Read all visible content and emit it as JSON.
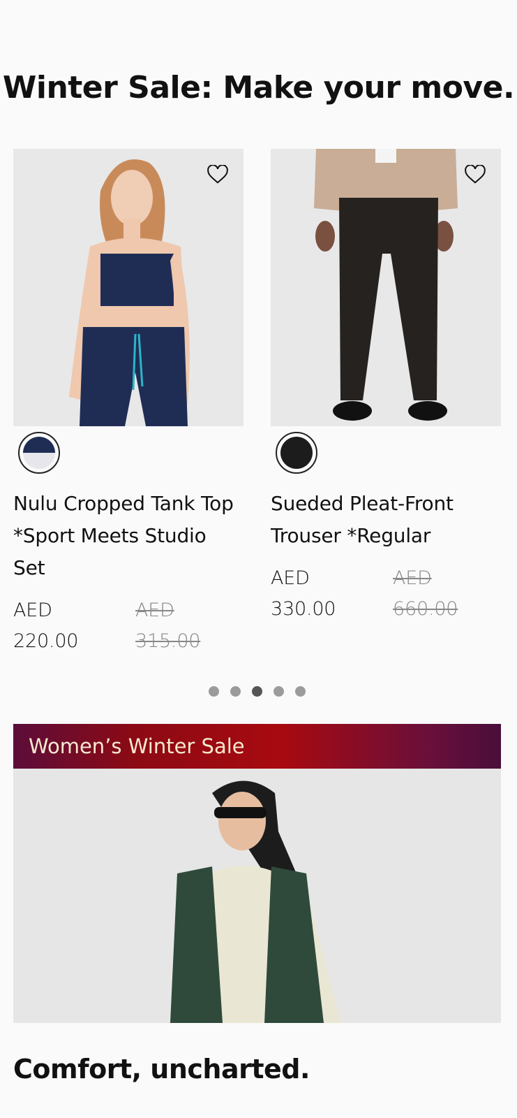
{
  "hero": {
    "title": "Winter Sale: Make your move."
  },
  "products": [
    {
      "name": "Nulu Cropped Tank Top *Sport Meets Studio Set",
      "price_currency": "AED",
      "price_now": "220.00",
      "price_was_currency": "AED",
      "price_was": "315.00",
      "swatch": "navy / light grey"
    },
    {
      "name": "Sueded Pleat-Front Trouser *Regular",
      "price_currency": "AED",
      "price_now": "330.00",
      "price_was_currency": "AED",
      "price_was": "660.00",
      "swatch": "black"
    }
  ],
  "carousel": {
    "total": 5,
    "active_index": 3
  },
  "banner": {
    "label": "Women’s Winter Sale"
  },
  "section": {
    "title": "Comfort, uncharted."
  },
  "colors": {
    "banner_red": "#a80a10",
    "banner_purple": "#5c0d3a",
    "swatch_navy": "#1f2d55",
    "swatch_black": "#1c1c1c"
  }
}
